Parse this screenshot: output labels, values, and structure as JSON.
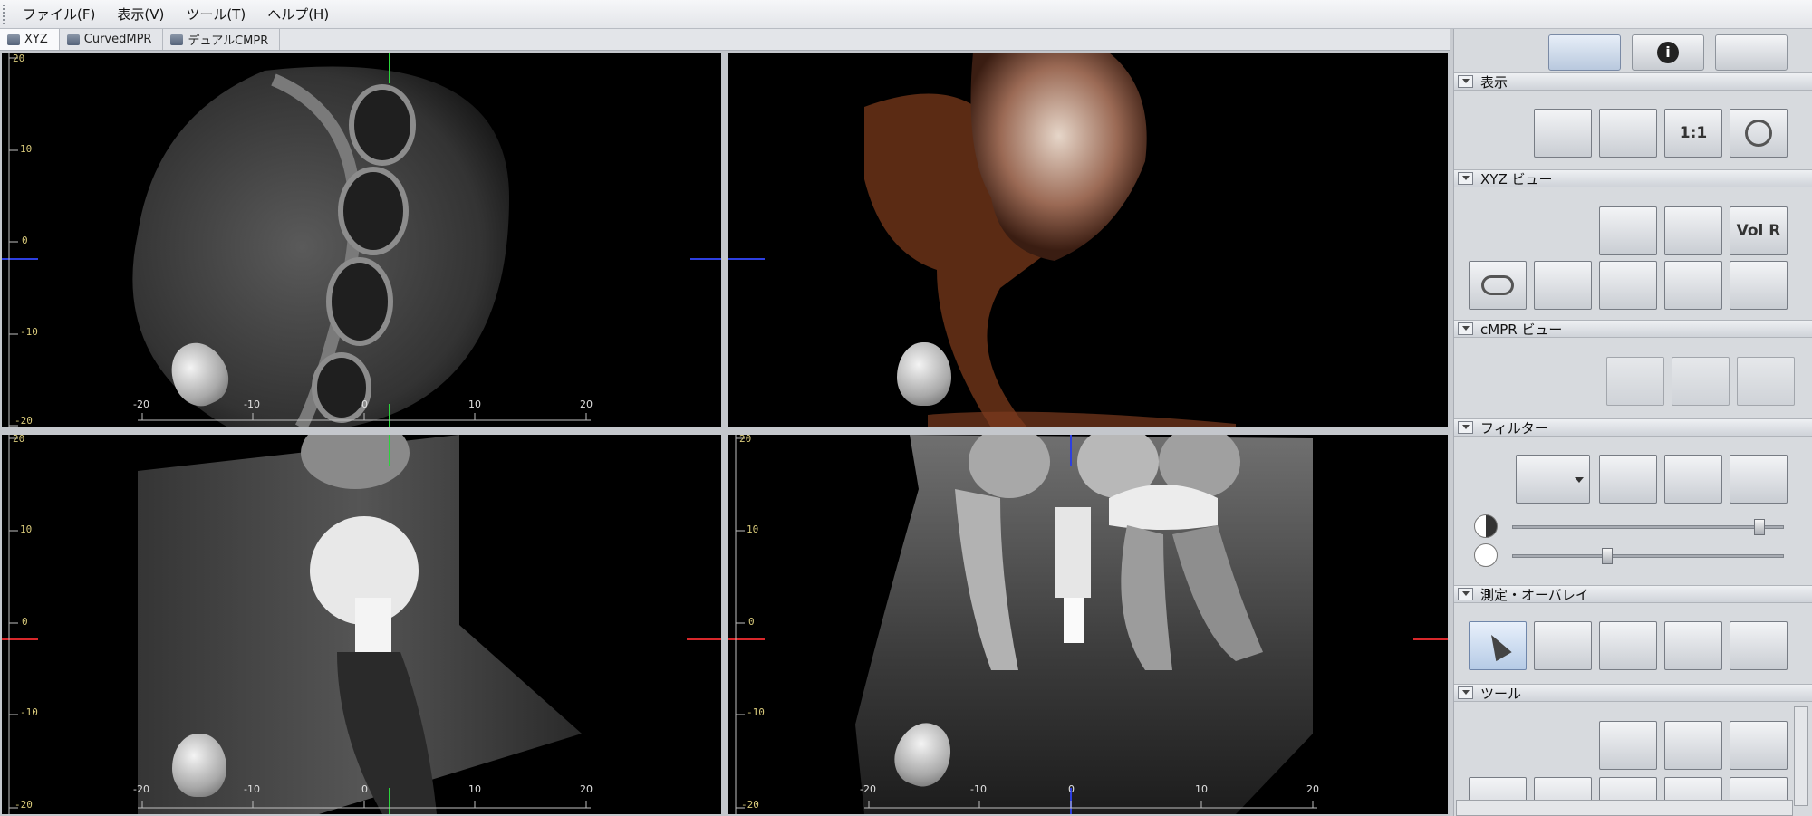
{
  "menu": [
    "ファイル(F)",
    "表示(V)",
    "ツール(T)",
    "ヘルプ(H)"
  ],
  "tabs": [
    "XYZ",
    "CurvedMPR",
    "デュアルCMPR"
  ],
  "ruler": {
    "v_labels": [
      "20",
      "10",
      "0",
      "-10",
      "-20"
    ],
    "h_labels": [
      "-20",
      "-10",
      "0",
      "10",
      "20"
    ]
  },
  "sections": {
    "display": "表示",
    "xyz_view": "XYZ ビュー",
    "cmpr_view": "cMPR ビュー",
    "filter": "フィルター",
    "measure": "測定・オーバレイ",
    "tools": "ツール"
  },
  "tool_text": {
    "one_to_one": "1:1",
    "vol_r": "Vol R"
  },
  "colors": {
    "viewport_bg": "#000000",
    "axis_green": "#2bd43b",
    "axis_blue": "#2d3fe0",
    "axis_red": "#d8282b",
    "ruler_text": "#d8c97a"
  },
  "sliders": {
    "contrast": 0.91,
    "brightness": 0.35
  }
}
